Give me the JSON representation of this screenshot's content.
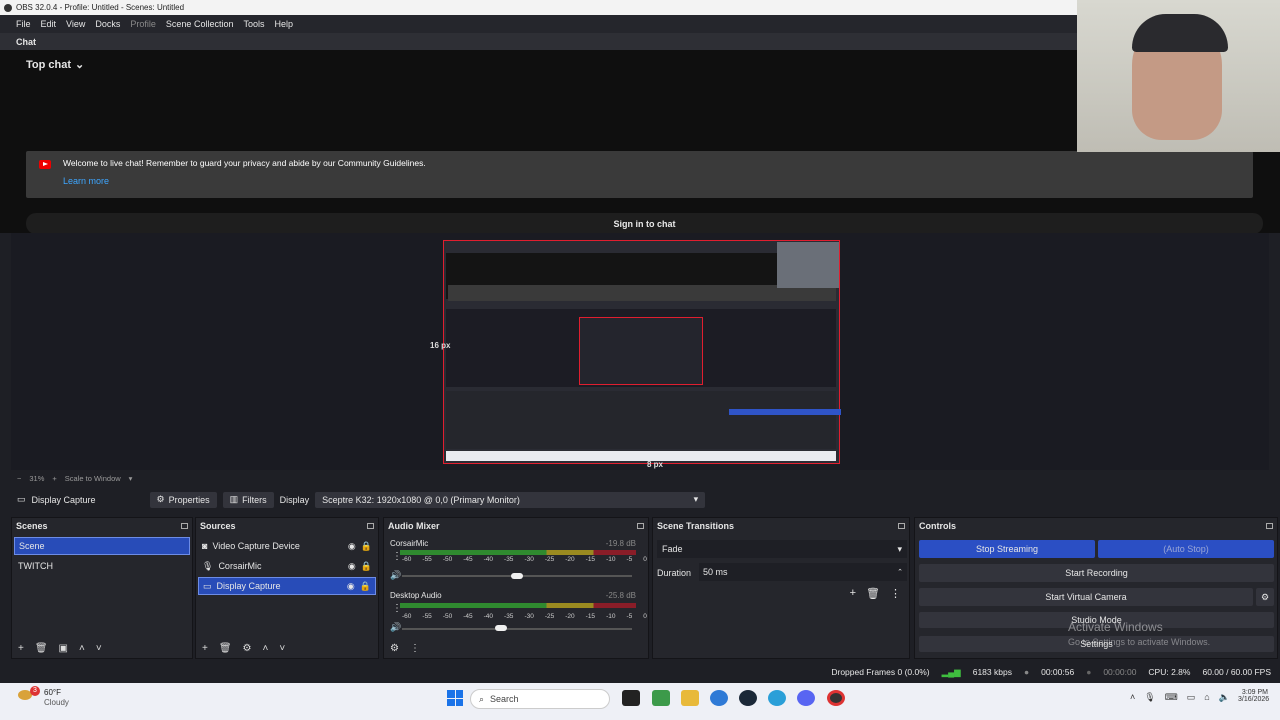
{
  "window": {
    "title": "OBS 32.0.4 - Profile: Untitled - Scenes: Untitled"
  },
  "menu": [
    "File",
    "Edit",
    "View",
    "Docks",
    "Profile",
    "Scene Collection",
    "Tools",
    "Help"
  ],
  "chat": {
    "header": "Chat",
    "top_chat": "Top chat",
    "welcome": "Welcome to live chat! Remember to guard your privacy and abide by our Community Guidelines.",
    "learn_more": "Learn more",
    "sign_in": "Sign in to chat"
  },
  "preview": {
    "px_label_left": "16 px",
    "px_label_bottom": "8 px",
    "zoom": "31%",
    "zoom_mode": "Scale to Window"
  },
  "source_toolbar": {
    "source": "Display Capture",
    "properties": "Properties",
    "filters": "Filters",
    "display_label": "Display",
    "display_value": "Sceptre K32: 1920x1080 @ 0,0 (Primary Monitor)"
  },
  "scenes": {
    "title": "Scenes",
    "items": [
      "Scene",
      "TWITCH"
    ]
  },
  "sources": {
    "title": "Sources",
    "items": [
      "Video Capture Device",
      "CorsairMic",
      "Display Capture"
    ]
  },
  "mixer": {
    "title": "Audio Mixer",
    "channels": [
      {
        "name": "CorsairMic",
        "db": "-19.8 dB",
        "fader": 0.6
      },
      {
        "name": "Desktop Audio",
        "db": "-25.8 dB",
        "fader": 0.5
      }
    ],
    "scale": [
      "-60",
      "-55",
      "-50",
      "-45",
      "-40",
      "-35",
      "-30",
      "-25",
      "-20",
      "-15",
      "-10",
      "-5",
      "0"
    ]
  },
  "transitions": {
    "title": "Scene Transitions",
    "type": "Fade",
    "duration_label": "Duration",
    "duration": "50 ms"
  },
  "controls": {
    "title": "Controls",
    "stop_streaming": "Stop Streaming",
    "auto_stop": "(Auto Stop)",
    "start_recording": "Start Recording",
    "start_virtual_camera": "Start Virtual Camera",
    "studio_mode": "Studio Mode",
    "settings": "Settings"
  },
  "watermark": {
    "line1": "Activate Windows",
    "line2": "Go to Settings to activate Windows."
  },
  "status": {
    "dropped": "Dropped Frames 0 (0.0%)",
    "kbps": "6183 kbps",
    "stream_time": "00:00:56",
    "rec_time": "00:00:00",
    "cpu": "CPU: 2.8%",
    "fps": "60.00 / 60.00 FPS"
  },
  "taskbar": {
    "weather_temp": "60°F",
    "weather_desc": "Cloudy",
    "weather_badge": "3",
    "search": "Search",
    "time": "3:09 PM",
    "date": "3/16/2026"
  }
}
